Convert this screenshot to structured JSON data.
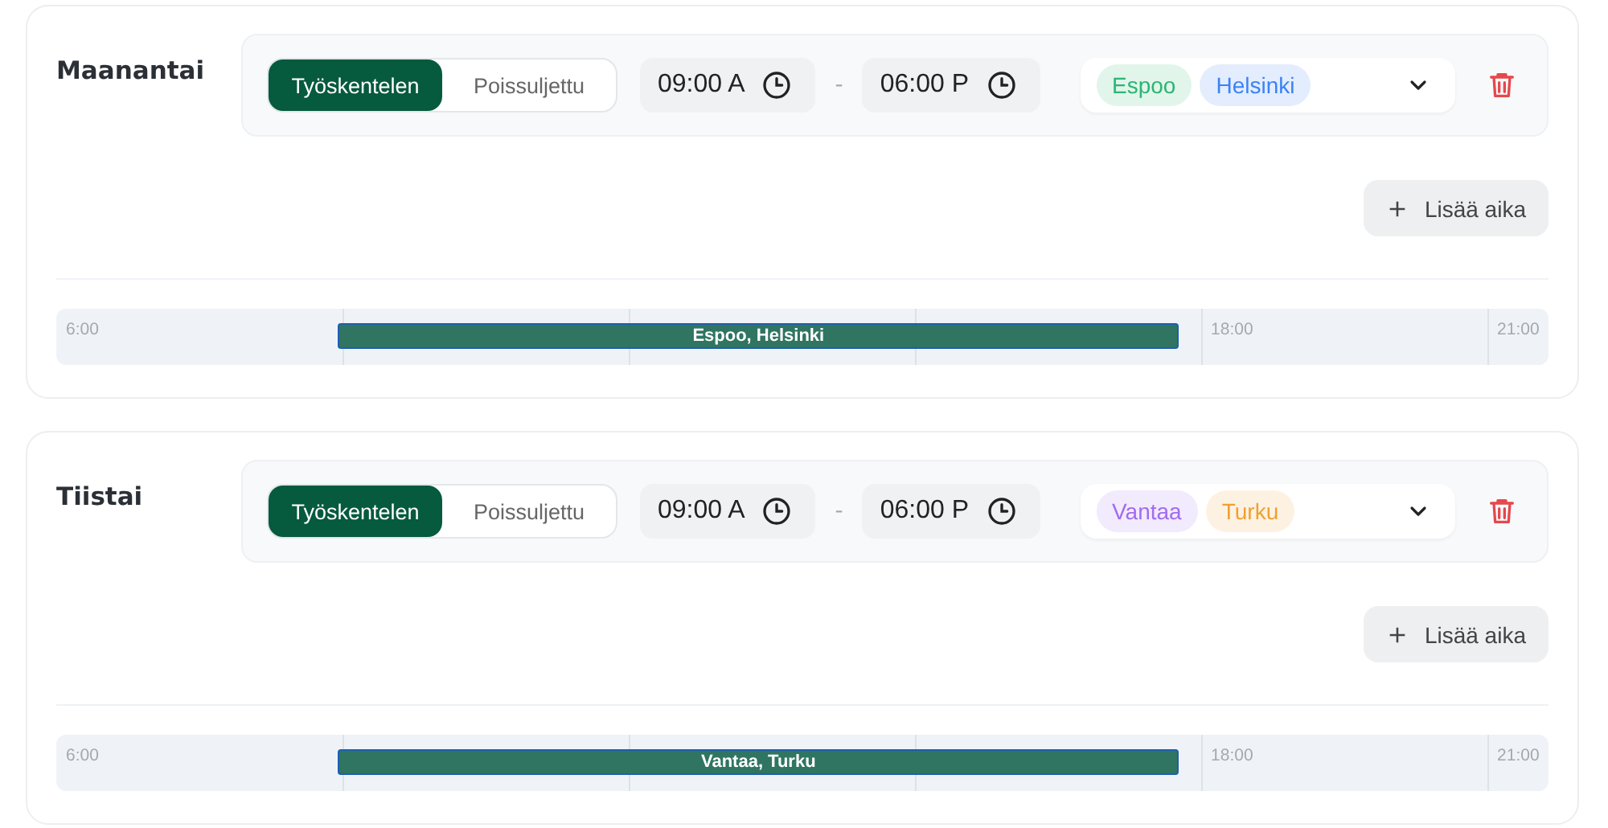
{
  "days": [
    {
      "name": "Maanantai",
      "modes": [
        {
          "label": "Työskentelen",
          "selected": true
        },
        {
          "label": "Poissuljettu",
          "selected": false
        }
      ],
      "start": "09:00 A",
      "separator": "-",
      "end": "06:00 P",
      "locations": [
        {
          "label": "Espoo",
          "color": "#2bb673"
        },
        {
          "label": "Helsinki",
          "color": "#3b82f6"
        }
      ],
      "add_button": "Lisää aika",
      "timeline": {
        "ticks": [
          "6:00",
          "18:00",
          "21:00"
        ],
        "bar_label": "Espoo, Helsinki"
      }
    },
    {
      "name": "Tiistai",
      "modes": [
        {
          "label": "Työskentelen",
          "selected": true
        },
        {
          "label": "Poissuljettu",
          "selected": false
        }
      ],
      "start": "09:00 A",
      "separator": "-",
      "end": "06:00 P",
      "locations": [
        {
          "label": "Vantaa",
          "color": "#a06cf0"
        },
        {
          "label": "Turku",
          "color": "#f0a030"
        }
      ],
      "add_button": "Lisää aika",
      "timeline": {
        "ticks": [
          "6:00",
          "18:00",
          "21:00"
        ],
        "bar_label": "Vantaa, Turku"
      }
    }
  ]
}
